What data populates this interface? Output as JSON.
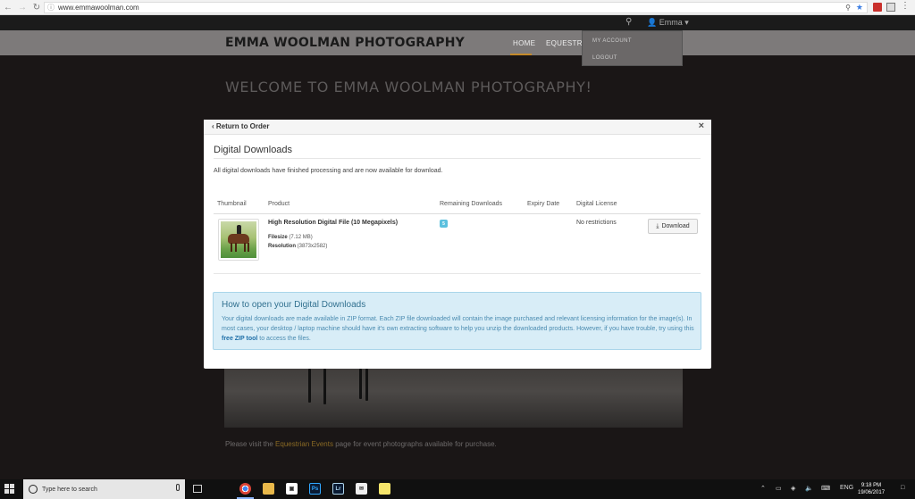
{
  "browser": {
    "url": "www.emmawoolman.com",
    "back_icon": "arrow-left-icon",
    "forward_icon": "arrow-right-icon",
    "reload_icon": "reload-icon",
    "info_icon": "info-icon",
    "star_icon": "star-icon"
  },
  "site": {
    "user_name": "Emma",
    "logo": "EMMA WOOLMAN PHOTOGRAPHY",
    "nav": {
      "home": "HOME",
      "equestrian": "EQUESTRIAN"
    },
    "user_menu": {
      "my_account": "MY ACCOUNT",
      "logout": "LOGOUT"
    },
    "welcome": "WELCOME TO EMMA WOOLMAN PHOTOGRAPHY!",
    "visit_prefix": "Please visit the ",
    "visit_link": "Equestrian Events",
    "visit_suffix": " page for event photographs available for purchase.",
    "accent_color": "#c48a2a"
  },
  "modal": {
    "return_label": "Return to Order",
    "close_label": "×",
    "title": "Digital Downloads",
    "message": "All digital downloads have finished processing and are now available for download.",
    "columns": {
      "thumbnail": "Thumbnail",
      "product": "Product",
      "remaining": "Remaining Downloads",
      "expiry": "Expiry Date",
      "license": "Digital License"
    },
    "item": {
      "name": "High Resolution Digital File (10 Megapixels)",
      "filesize_label": "Filesize",
      "filesize_value": "(7.12 MB)",
      "resolution_label": "Resolution",
      "resolution_value": "(3873x2582)",
      "remaining": "5",
      "expiry": "",
      "license": "No restrictions",
      "download_label": "Download"
    },
    "info": {
      "title": "How to open your Digital Downloads",
      "text_before": "Your digital downloads are made available in ZIP format. Each ZIP file downloaded will contain the image purchased and relevant licensing information for the image(s). In most cases, your desktop / laptop machine should have it's own extracting software to help you unzip the downloaded products. However, if you have trouble, try using this ",
      "link": "free ZIP tool",
      "text_after": " to access the files."
    }
  },
  "taskbar": {
    "search_placeholder": "Type here to search",
    "lang": "ENG",
    "time": "9:18 PM",
    "date": "19/06/2017",
    "apps": [
      {
        "name": "task-view-icon",
        "label": ""
      },
      {
        "name": "chrome-icon",
        "label": ""
      },
      {
        "name": "file-explorer-icon",
        "label": ""
      },
      {
        "name": "store-icon",
        "label": ""
      },
      {
        "name": "photoshop-icon",
        "label": "Ps"
      },
      {
        "name": "lightroom-icon",
        "label": "Lr"
      },
      {
        "name": "mail-icon",
        "label": ""
      },
      {
        "name": "sticky-notes-icon",
        "label": ""
      }
    ]
  }
}
